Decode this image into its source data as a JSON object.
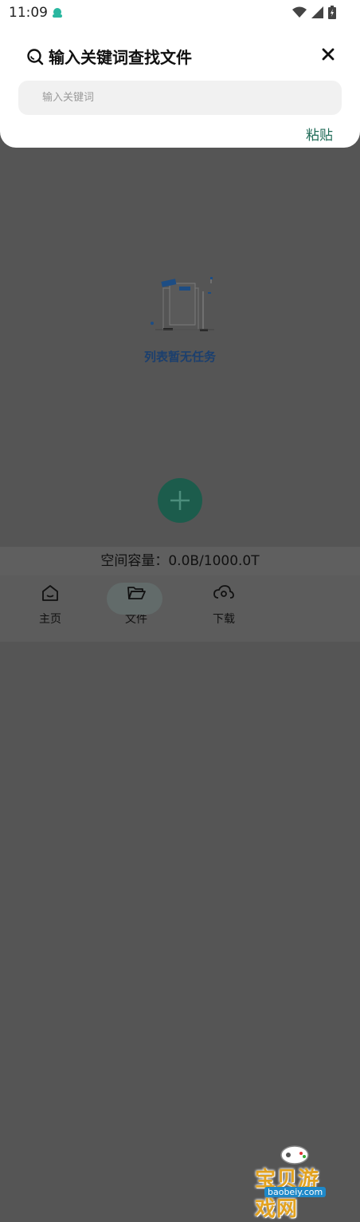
{
  "status_bar": {
    "time": "11:09"
  },
  "search_sheet": {
    "title": "输入关键词查找文件",
    "placeholder": "输入关键词",
    "value": "",
    "paste_label": "粘贴"
  },
  "empty_state": {
    "message": "列表暂无任务"
  },
  "storage": {
    "capacity_text": "空间容量：0.0B/1000.0T"
  },
  "bottom_nav": {
    "items": [
      {
        "label": "主页",
        "icon": "home-icon"
      },
      {
        "label": "文件",
        "icon": "folder-open-icon",
        "active": true
      },
      {
        "label": "下载",
        "icon": "cloud-download-icon"
      }
    ]
  },
  "watermark": {
    "text": "宝贝游戏网",
    "url": "baobeiy.com"
  },
  "colors": {
    "accent": "#1f6b57",
    "fab": "#1c5c4c",
    "empty_text": "#1b3f6e"
  }
}
